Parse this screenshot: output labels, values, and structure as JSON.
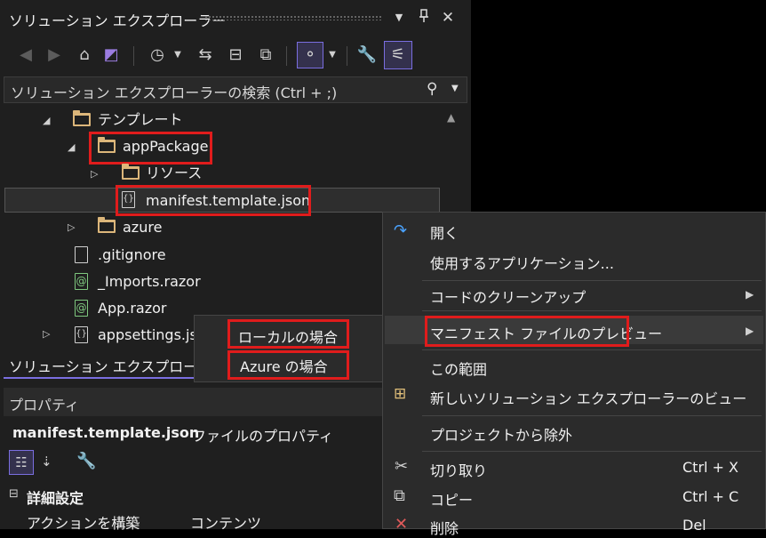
{
  "solution_explorer": {
    "title": "ソリューション エクスプローラー",
    "title_icons": {
      "dropdown": "▼",
      "pin": "📌",
      "close": "✕"
    },
    "search_placeholder": "ソリューション エクスプローラーの検索 (Ctrl + ;)",
    "tree": [
      {
        "label": "テンプレート",
        "type": "folder",
        "expanded": true
      },
      {
        "label": "appPackage",
        "type": "folder",
        "expanded": true,
        "highlighted": true
      },
      {
        "label": "リソース",
        "type": "folder",
        "expanded": false
      },
      {
        "label": "manifest.template.json",
        "type": "json",
        "selected": true,
        "highlighted": true
      },
      {
        "label": "azure",
        "type": "folder",
        "expanded": false
      },
      {
        "label": ".gitignore",
        "type": "file"
      },
      {
        "label": "_Imports.razor",
        "type": "razor"
      },
      {
        "label": "App.razor",
        "type": "razor"
      },
      {
        "label": "appsettings.js",
        "type": "json",
        "expanded": false
      }
    ],
    "tab_label": "ソリューション エクスプローラー"
  },
  "properties": {
    "title": "プロパティ",
    "file_name": "manifest.template.json",
    "file_suffix": "ファイルのプロパティ",
    "category": "詳細設定",
    "row_name": "アクションを構築",
    "row_value": "コンテンツ"
  },
  "submenu": {
    "items": [
      "ローカルの場合",
      "Azure の場合"
    ]
  },
  "context_menu": {
    "items": [
      {
        "label": "開く"
      },
      {
        "label": "使用するアプリケーション..."
      },
      {
        "label": "コードのクリーンアップ",
        "has_submenu": true
      },
      {
        "label": "マニフェスト ファイルのプレビュー",
        "has_submenu": true,
        "highlighted": true
      },
      {
        "label": "この範囲"
      },
      {
        "label": "新しいソリューション エクスプローラーのビュー"
      },
      {
        "label": "プロジェクトから除外"
      },
      {
        "label": "切り取り",
        "shortcut": "Ctrl + X"
      },
      {
        "label": "コピー",
        "shortcut": "Ctrl + C"
      },
      {
        "label": "削除",
        "shortcut": "Del"
      }
    ]
  },
  "colors": {
    "panel_bg": "#1f1f1f",
    "menu_bg": "#2b2b2b",
    "accent": "#7a6ee0",
    "highlight_box": "#e01c1c",
    "folder": "#dcb67a"
  }
}
